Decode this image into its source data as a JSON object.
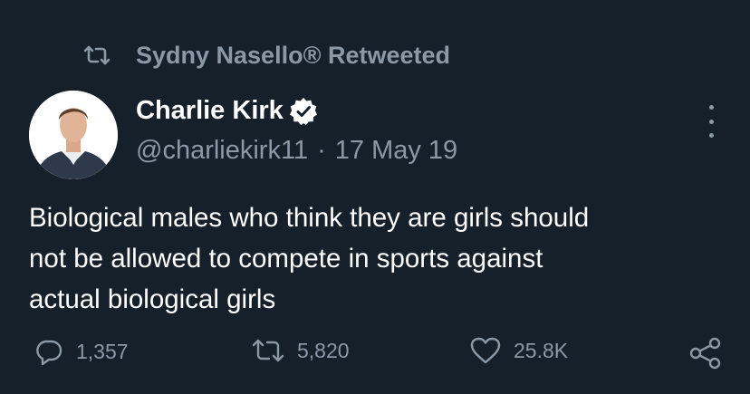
{
  "retweet_banner": {
    "icon": "retweet-icon",
    "text": "Sydny Nasello® Retweeted"
  },
  "author": {
    "name": "Charlie Kirk",
    "verified_icon": "verified-badge-icon",
    "handle": "@charliekirk11",
    "separator": "·",
    "date": "17 May 19"
  },
  "tweet": {
    "lines": [
      "Biological males who think they are girls should",
      "not be allowed to compete in sports against",
      "actual biological girls"
    ]
  },
  "actions": {
    "reply_count": "1,357",
    "retweet_count": "5,820",
    "like_count": "25.8K",
    "share_icon": "share-icon"
  },
  "colors": {
    "background": "#15202b",
    "primary_text": "#ffffff",
    "secondary_text": "#8b98a5"
  }
}
